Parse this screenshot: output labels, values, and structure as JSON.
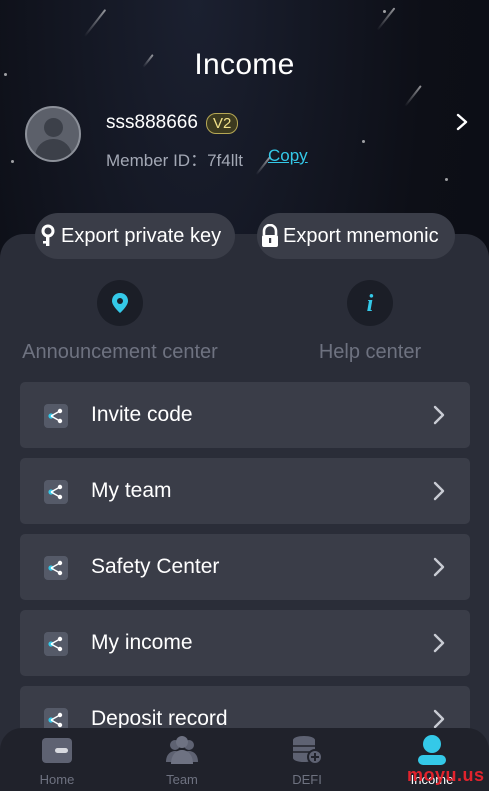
{
  "header": {
    "title": "Income"
  },
  "profile": {
    "username": "sss888666",
    "level": "V2",
    "member_id_label": "Member ID：7f4llt",
    "copy_label": "Copy"
  },
  "actions": {
    "export_key": "Export private key",
    "export_mnemonic": "Export mnemonic"
  },
  "services": {
    "announcement": "Announcement center",
    "help": "Help center"
  },
  "menu": [
    {
      "label": "Invite code"
    },
    {
      "label": "My team"
    },
    {
      "label": "Safety Center"
    },
    {
      "label": "My income"
    },
    {
      "label": "Deposit record"
    }
  ],
  "tabs": [
    {
      "label": "Home",
      "icon": "wallet-icon"
    },
    {
      "label": "Team",
      "icon": "team-icon"
    },
    {
      "label": "DEFI",
      "icon": "coins-icon"
    },
    {
      "label": "Income",
      "icon": "user-icon",
      "active": true
    }
  ],
  "watermark": "moyu.us",
  "colors": {
    "accent": "#34c9e8",
    "badge": "#f1e189",
    "panel": "#2a2d38",
    "row": "#3a3d48",
    "watermark": "#e1232d"
  }
}
